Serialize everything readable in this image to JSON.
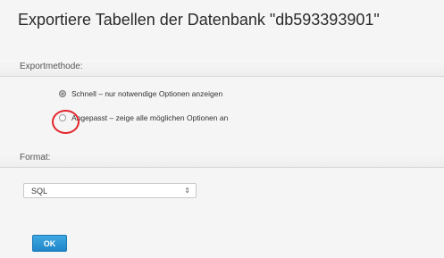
{
  "page_title": "Exportiere Tabellen der Datenbank \"db593393901\"",
  "export_method": {
    "header": "Exportmethode:",
    "options": [
      {
        "label": "Schnell – nur notwendige Optionen anzeigen",
        "selected": true
      },
      {
        "label": "Angepasst – zeige alle möglichen Optionen an",
        "selected": false
      }
    ]
  },
  "format": {
    "header": "Format:",
    "selected_value": "SQL"
  },
  "ok_button_label": "OK",
  "colors": {
    "ok_button": "#1f87c9",
    "highlight_circle": "#e2262b"
  }
}
